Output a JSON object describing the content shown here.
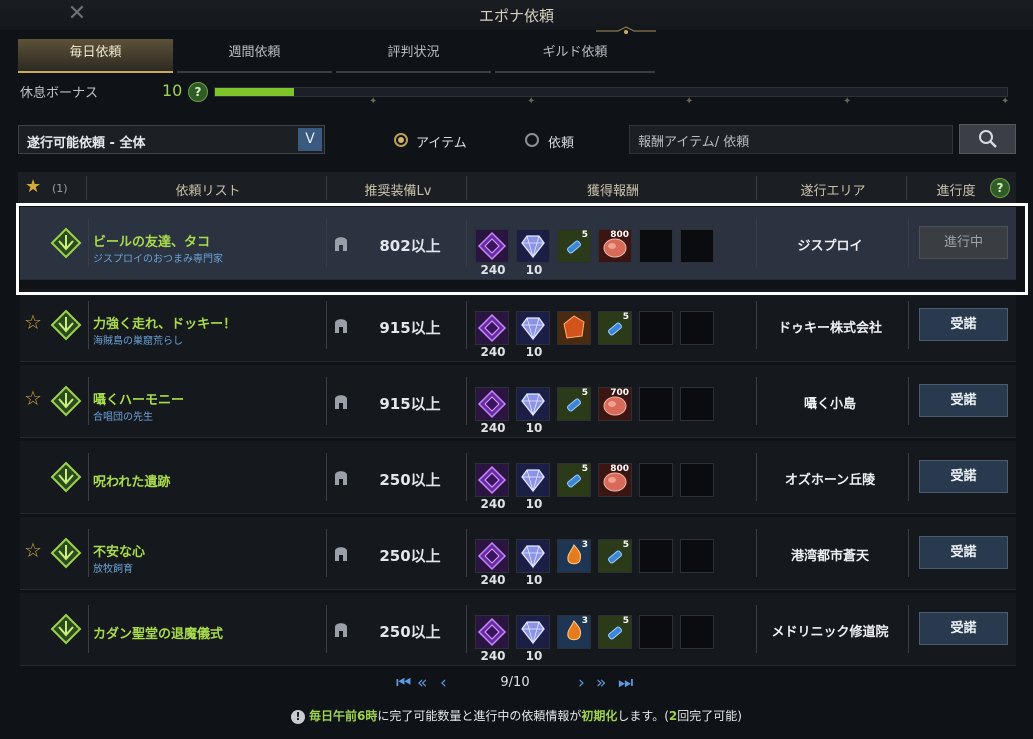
{
  "window": {
    "title": "エポナ依頼",
    "close_glyph": "✕"
  },
  "tabs": [
    {
      "label": "毎日依頼",
      "active": true
    },
    {
      "label": "週間依頼",
      "active": false
    },
    {
      "label": "評判状況",
      "active": false
    },
    {
      "label": "ギルド依頼",
      "active": false
    }
  ],
  "rest_bonus": {
    "label": "休息ボーナス",
    "value": "10",
    "help": "?",
    "progress": 0.1
  },
  "filter": {
    "selected": "遂行可能依頼 - 全体",
    "chevron": "V"
  },
  "radio": {
    "item_label": "アイテム",
    "quest_label": "依頼",
    "selected": "item"
  },
  "search": {
    "placeholder": "報酬アイテム/ 依頼",
    "icon": "search-icon"
  },
  "table_header": {
    "fav_count": "(1)",
    "quest_list": "依頼リスト",
    "level": "推奨装備Lv",
    "rewards": "獲得報酬",
    "area": "遂行エリア",
    "progress": "進行度",
    "help": "?"
  },
  "rows": [
    {
      "fav": false,
      "name": "ビールの友達、タコ",
      "giver": "ジスプロイのおつまみ専門家",
      "level": "802以上",
      "area": "ジスプロイ",
      "action": "進行中",
      "selected": true,
      "rewards": [
        {
          "icon": "purple-gem",
          "label": "240"
        },
        {
          "icon": "blue-crystal",
          "label": "10"
        },
        {
          "icon": "blue-potion",
          "count": "5"
        },
        {
          "icon": "meat",
          "count": "800"
        }
      ]
    },
    {
      "fav": true,
      "name": "力強く走れ、ドッキー！",
      "giver": "海賊島の巣窟荒らし",
      "level": "915以上",
      "area": "ドゥキー株式会社",
      "action": "受諾",
      "rewards": [
        {
          "icon": "purple-gem",
          "label": "240"
        },
        {
          "icon": "blue-crystal",
          "label": "10"
        },
        {
          "icon": "red-crystal"
        },
        {
          "icon": "blue-potion",
          "count": "5"
        }
      ]
    },
    {
      "fav": true,
      "name": "囁くハーモニー",
      "giver": "合唱団の先生",
      "level": "915以上",
      "area": "囁く小島",
      "action": "受諾",
      "rewards": [
        {
          "icon": "purple-gem",
          "label": "240"
        },
        {
          "icon": "blue-crystal",
          "label": "10"
        },
        {
          "icon": "blue-potion",
          "count": "5"
        },
        {
          "icon": "meat",
          "count": "700"
        }
      ]
    },
    {
      "fav": false,
      "name": "呪われた遺跡",
      "giver": "",
      "level": "250以上",
      "area": "オズホーン丘陵",
      "action": "受諾",
      "rewards": [
        {
          "icon": "purple-gem",
          "label": "240"
        },
        {
          "icon": "blue-crystal",
          "label": "10"
        },
        {
          "icon": "blue-potion",
          "count": "5"
        },
        {
          "icon": "meat",
          "count": "800"
        }
      ]
    },
    {
      "fav": true,
      "name": "不安な心",
      "giver": "放牧飼育",
      "level": "250以上",
      "area": "港湾都市蒼天",
      "action": "受諾",
      "rewards": [
        {
          "icon": "purple-gem",
          "label": "240"
        },
        {
          "icon": "blue-crystal",
          "label": "10"
        },
        {
          "icon": "fire-stone",
          "count": "3"
        },
        {
          "icon": "blue-potion",
          "count": "5"
        }
      ]
    },
    {
      "fav": false,
      "name": "カダン聖堂の退魔儀式",
      "giver": "",
      "level": "250以上",
      "area": "メドリニック修道院",
      "action": "受諾",
      "rewards": [
        {
          "icon": "purple-gem",
          "label": "240"
        },
        {
          "icon": "blue-crystal",
          "label": "10"
        },
        {
          "icon": "fire-stone",
          "count": "3"
        },
        {
          "icon": "blue-potion",
          "count": "5"
        }
      ]
    }
  ],
  "pager": {
    "first": "K",
    "prev_many": "«",
    "prev": "‹",
    "page": "9/10",
    "next": "›",
    "next_many": "»",
    "last": "K"
  },
  "notice": {
    "p1": "毎日午前6時",
    "p2": "に完了可能数量と進行中の依頼情報が",
    "p3": "初期化",
    "p4": "します。(",
    "p5": "2",
    "p6": "回完了可能)"
  },
  "colors": {
    "accent_green": "#9ed34f",
    "button_blue": "#2a3a4e",
    "gold": "#c9a95c"
  }
}
